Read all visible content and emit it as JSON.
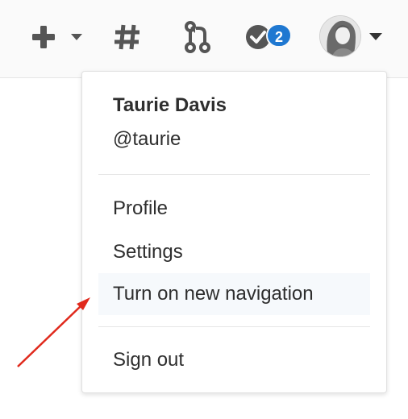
{
  "topbar": {
    "new_menu_icon": "plus-icon",
    "new_menu_caret": "caret-down-icon",
    "issues_icon": "hash-icon",
    "merge_requests_icon": "merge-request-icon",
    "todos_icon": "todo-check-icon",
    "todos_count": "2",
    "user_menu_caret": "caret-down-icon"
  },
  "user_menu": {
    "name": "Taurie Davis",
    "username": "@taurie",
    "items": [
      {
        "label": "Profile"
      },
      {
        "label": "Settings"
      },
      {
        "label": "Turn on new navigation",
        "highlighted": true
      },
      {
        "label": "Sign out"
      }
    ]
  },
  "colors": {
    "icon": "#555555",
    "badge": "#1f78d1",
    "highlight": "#f6f9fc",
    "annotation_arrow": "#e0291c"
  }
}
